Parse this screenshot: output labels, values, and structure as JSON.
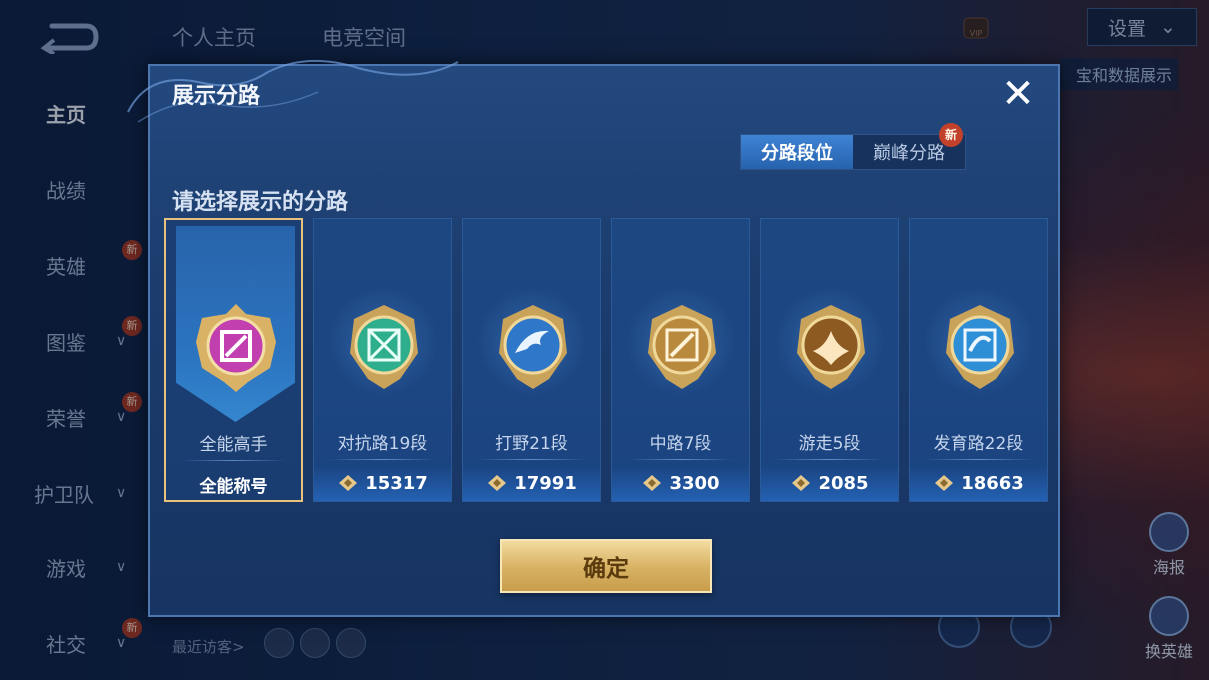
{
  "header": {
    "tabs": [
      "个人主页",
      "电竞空间"
    ],
    "settings_label": "设置",
    "vip_label": "VIP",
    "banner_text": "宝和数据展示"
  },
  "left_nav": {
    "items": [
      {
        "label": "主页",
        "active": true
      },
      {
        "label": "战绩"
      },
      {
        "label": "英雄",
        "badge": "新"
      },
      {
        "label": "图鉴",
        "badge": "新",
        "expand": true
      },
      {
        "label": "荣誉",
        "badge": "新",
        "expand": true
      },
      {
        "label": "护卫队",
        "expand": true
      },
      {
        "label": "游戏",
        "expand": true
      },
      {
        "label": "社交",
        "badge": "新",
        "expand": true
      }
    ]
  },
  "footer": {
    "recent_visitors": "最近访客>"
  },
  "right_buttons": {
    "poster": "海报",
    "change_hero": "换英雄"
  },
  "modal": {
    "title": "展示分路",
    "close_icon": "close-icon",
    "toggle": {
      "options": [
        "分路段位",
        "巅峰分路"
      ],
      "active_index": 0,
      "new_badge": "新"
    },
    "prompt": "请选择展示的分路",
    "cards": [
      {
        "label": "全能高手",
        "footer": "全能称号",
        "selected": true,
        "emblem_color": "#c23fb0",
        "icon": "all-round-emblem-icon"
      },
      {
        "label": "对抗路19段",
        "footer": "15317",
        "emblem_color": "#2fae8e",
        "icon": "clash-lane-emblem-icon"
      },
      {
        "label": "打野21段",
        "footer": "17991",
        "emblem_color": "#2f77c8",
        "icon": "jungle-emblem-icon"
      },
      {
        "label": "中路7段",
        "footer": "3300",
        "emblem_color": "#b98a3e",
        "icon": "mid-lane-emblem-icon"
      },
      {
        "label": "游走5段",
        "footer": "2085",
        "emblem_color": "#b07a36",
        "icon": "roam-emblem-icon"
      },
      {
        "label": "发育路22段",
        "footer": "18663",
        "emblem_color": "#2f8fd6",
        "icon": "farm-lane-emblem-icon"
      }
    ],
    "confirm_label": "确定"
  },
  "colors": {
    "accent_gold": "#e8c27a",
    "toggle_active": "#2f72c4",
    "modal_bg": "#1d4177"
  }
}
